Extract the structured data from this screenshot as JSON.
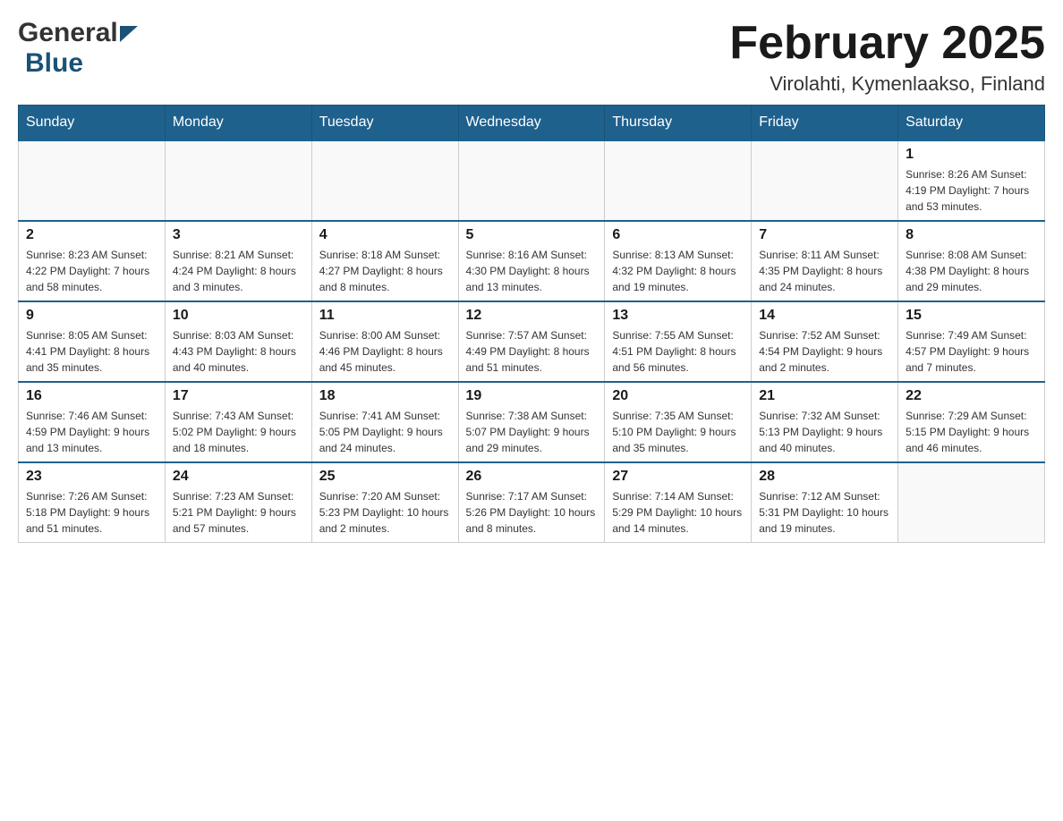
{
  "header": {
    "logo_general": "General",
    "logo_blue": "Blue",
    "title": "February 2025",
    "subtitle": "Virolahti, Kymenlaakso, Finland"
  },
  "weekdays": [
    "Sunday",
    "Monday",
    "Tuesday",
    "Wednesday",
    "Thursday",
    "Friday",
    "Saturday"
  ],
  "weeks": [
    [
      {
        "day": "",
        "info": ""
      },
      {
        "day": "",
        "info": ""
      },
      {
        "day": "",
        "info": ""
      },
      {
        "day": "",
        "info": ""
      },
      {
        "day": "",
        "info": ""
      },
      {
        "day": "",
        "info": ""
      },
      {
        "day": "1",
        "info": "Sunrise: 8:26 AM\nSunset: 4:19 PM\nDaylight: 7 hours and 53 minutes."
      }
    ],
    [
      {
        "day": "2",
        "info": "Sunrise: 8:23 AM\nSunset: 4:22 PM\nDaylight: 7 hours and 58 minutes."
      },
      {
        "day": "3",
        "info": "Sunrise: 8:21 AM\nSunset: 4:24 PM\nDaylight: 8 hours and 3 minutes."
      },
      {
        "day": "4",
        "info": "Sunrise: 8:18 AM\nSunset: 4:27 PM\nDaylight: 8 hours and 8 minutes."
      },
      {
        "day": "5",
        "info": "Sunrise: 8:16 AM\nSunset: 4:30 PM\nDaylight: 8 hours and 13 minutes."
      },
      {
        "day": "6",
        "info": "Sunrise: 8:13 AM\nSunset: 4:32 PM\nDaylight: 8 hours and 19 minutes."
      },
      {
        "day": "7",
        "info": "Sunrise: 8:11 AM\nSunset: 4:35 PM\nDaylight: 8 hours and 24 minutes."
      },
      {
        "day": "8",
        "info": "Sunrise: 8:08 AM\nSunset: 4:38 PM\nDaylight: 8 hours and 29 minutes."
      }
    ],
    [
      {
        "day": "9",
        "info": "Sunrise: 8:05 AM\nSunset: 4:41 PM\nDaylight: 8 hours and 35 minutes."
      },
      {
        "day": "10",
        "info": "Sunrise: 8:03 AM\nSunset: 4:43 PM\nDaylight: 8 hours and 40 minutes."
      },
      {
        "day": "11",
        "info": "Sunrise: 8:00 AM\nSunset: 4:46 PM\nDaylight: 8 hours and 45 minutes."
      },
      {
        "day": "12",
        "info": "Sunrise: 7:57 AM\nSunset: 4:49 PM\nDaylight: 8 hours and 51 minutes."
      },
      {
        "day": "13",
        "info": "Sunrise: 7:55 AM\nSunset: 4:51 PM\nDaylight: 8 hours and 56 minutes."
      },
      {
        "day": "14",
        "info": "Sunrise: 7:52 AM\nSunset: 4:54 PM\nDaylight: 9 hours and 2 minutes."
      },
      {
        "day": "15",
        "info": "Sunrise: 7:49 AM\nSunset: 4:57 PM\nDaylight: 9 hours and 7 minutes."
      }
    ],
    [
      {
        "day": "16",
        "info": "Sunrise: 7:46 AM\nSunset: 4:59 PM\nDaylight: 9 hours and 13 minutes."
      },
      {
        "day": "17",
        "info": "Sunrise: 7:43 AM\nSunset: 5:02 PM\nDaylight: 9 hours and 18 minutes."
      },
      {
        "day": "18",
        "info": "Sunrise: 7:41 AM\nSunset: 5:05 PM\nDaylight: 9 hours and 24 minutes."
      },
      {
        "day": "19",
        "info": "Sunrise: 7:38 AM\nSunset: 5:07 PM\nDaylight: 9 hours and 29 minutes."
      },
      {
        "day": "20",
        "info": "Sunrise: 7:35 AM\nSunset: 5:10 PM\nDaylight: 9 hours and 35 minutes."
      },
      {
        "day": "21",
        "info": "Sunrise: 7:32 AM\nSunset: 5:13 PM\nDaylight: 9 hours and 40 minutes."
      },
      {
        "day": "22",
        "info": "Sunrise: 7:29 AM\nSunset: 5:15 PM\nDaylight: 9 hours and 46 minutes."
      }
    ],
    [
      {
        "day": "23",
        "info": "Sunrise: 7:26 AM\nSunset: 5:18 PM\nDaylight: 9 hours and 51 minutes."
      },
      {
        "day": "24",
        "info": "Sunrise: 7:23 AM\nSunset: 5:21 PM\nDaylight: 9 hours and 57 minutes."
      },
      {
        "day": "25",
        "info": "Sunrise: 7:20 AM\nSunset: 5:23 PM\nDaylight: 10 hours and 2 minutes."
      },
      {
        "day": "26",
        "info": "Sunrise: 7:17 AM\nSunset: 5:26 PM\nDaylight: 10 hours and 8 minutes."
      },
      {
        "day": "27",
        "info": "Sunrise: 7:14 AM\nSunset: 5:29 PM\nDaylight: 10 hours and 14 minutes."
      },
      {
        "day": "28",
        "info": "Sunrise: 7:12 AM\nSunset: 5:31 PM\nDaylight: 10 hours and 19 minutes."
      },
      {
        "day": "",
        "info": ""
      }
    ]
  ]
}
